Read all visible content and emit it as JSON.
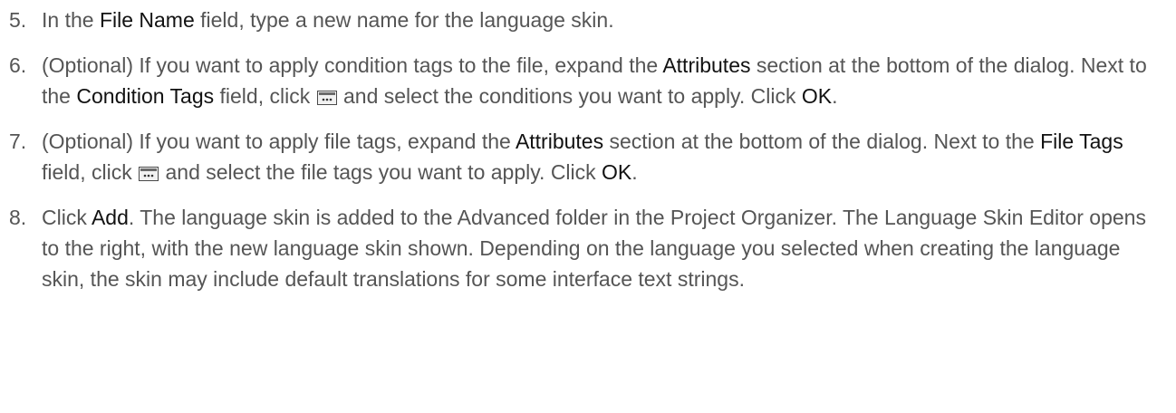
{
  "steps": [
    {
      "number": "5.",
      "parts": [
        {
          "t": "In the "
        },
        {
          "b": "File Name"
        },
        {
          "t": " field, type a new name for the language skin."
        }
      ]
    },
    {
      "number": "6.",
      "parts": [
        {
          "t": "(Optional) If you want to apply condition tags to the file, expand the "
        },
        {
          "b": "Attributes"
        },
        {
          "t": " section at the bottom of the dialog. Next to the "
        },
        {
          "b": "Condition Tags"
        },
        {
          "t": " field, click "
        },
        {
          "icon": "ellipsis-button-icon"
        },
        {
          "t": " and select the conditions you want to apply. Click "
        },
        {
          "b": "OK"
        },
        {
          "t": "."
        }
      ]
    },
    {
      "number": "7.",
      "parts": [
        {
          "t": "(Optional) If you want to apply file tags, expand the "
        },
        {
          "b": "Attributes"
        },
        {
          "t": " section at the bottom of the dialog. Next to the "
        },
        {
          "b": "File Tags"
        },
        {
          "t": " field, click "
        },
        {
          "icon": "ellipsis-button-icon"
        },
        {
          "t": " and select the file tags you want to apply. Click "
        },
        {
          "b": "OK"
        },
        {
          "t": "."
        }
      ]
    },
    {
      "number": "8.",
      "parts": [
        {
          "t": "Click "
        },
        {
          "b": "Add"
        },
        {
          "t": ". The language skin is added to the Advanced folder in the Project Organizer. The Language Skin Editor opens to the right, with the new language skin shown. Depending on the language you selected when creating the language skin, the skin may include default translations for some interface text strings."
        }
      ]
    }
  ],
  "colors": {
    "body_text": "#555555",
    "emphasis_text": "#111111",
    "icon_border": "#4a4a4a"
  }
}
